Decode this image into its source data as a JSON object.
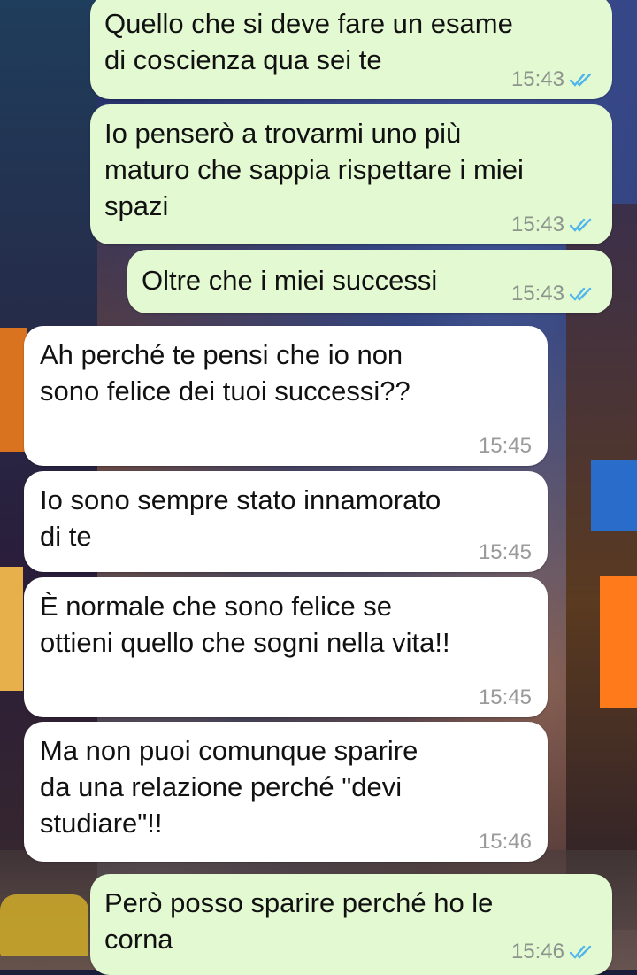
{
  "colors": {
    "outgoing_bubble": "#e3f9d2",
    "incoming_bubble": "#ffffff",
    "read_ticks": "#4fb6ec",
    "time_text": "#8c948c"
  },
  "messages": [
    {
      "direction": "outgoing",
      "text": "Quello che si deve fare un esame\ndi coscienza qua sei te",
      "time": "15:43",
      "status": "read"
    },
    {
      "direction": "outgoing",
      "text": "Io penserò a trovarmi uno più\nmaturo che sappia rispettare i miei\nspazi",
      "time": "15:43",
      "status": "read"
    },
    {
      "direction": "outgoing",
      "text": "Oltre che i miei successi",
      "time": "15:43",
      "status": "read"
    },
    {
      "direction": "incoming",
      "text": "Ah perché te pensi che io non\nsono felice dei tuoi successi??",
      "time": "15:45"
    },
    {
      "direction": "incoming",
      "text": "Io sono sempre stato innamorato\ndi te",
      "time": "15:45"
    },
    {
      "direction": "incoming",
      "text": "È normale che sono felice se\nottieni quello che sogni nella vita!!",
      "time": "15:45"
    },
    {
      "direction": "incoming",
      "text": "Ma non puoi comunque sparire\nda una relazione perché \"devi\nstudiare\"!!",
      "time": "15:46"
    },
    {
      "direction": "outgoing",
      "text": "Però posso sparire perché ho le\ncorna",
      "time": "15:46",
      "status": "read"
    }
  ]
}
